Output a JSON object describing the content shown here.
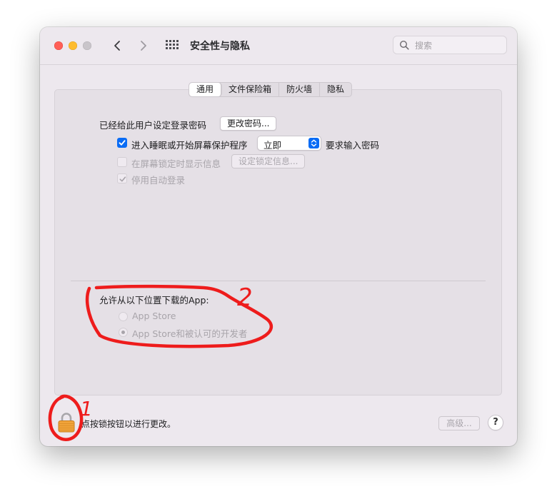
{
  "window": {
    "title": "安全性与隐私",
    "search_placeholder": "搜索"
  },
  "tabs": [
    {
      "label": "通用",
      "active": true
    },
    {
      "label": "文件保险箱",
      "active": false
    },
    {
      "label": "防火墙",
      "active": false
    },
    {
      "label": "隐私",
      "active": false
    }
  ],
  "general": {
    "password_label": "已经给此用户设定登录密码",
    "change_password_button": "更改密码...",
    "require_password": {
      "checked": true,
      "label_prefix": "进入睡眠或开始屏幕保护程序",
      "delay_value": "立即",
      "label_suffix": "要求输入密码"
    },
    "show_message": {
      "checked": false,
      "enabled": false,
      "label": "在屏幕锁定时显示信息",
      "button": "设定锁定信息..."
    },
    "disable_auto_login": {
      "checked": true,
      "enabled": false,
      "label": "停用自动登录"
    }
  },
  "downloads": {
    "heading": "允许从以下位置下载的App:",
    "options": [
      {
        "label": "App Store",
        "selected": false
      },
      {
        "label": "App Store和被认可的开发者",
        "selected": true
      }
    ]
  },
  "footer": {
    "lock_text": "点按锁按钮以进行更改。",
    "advanced_button": "高级...",
    "help_button": "?"
  },
  "annotations": {
    "mark_1": "1",
    "mark_2": "2",
    "color": "#ee1c1c"
  },
  "colors": {
    "accent": "#0a6cf5",
    "close": "#ff5f57",
    "minimize": "#febc2e"
  }
}
